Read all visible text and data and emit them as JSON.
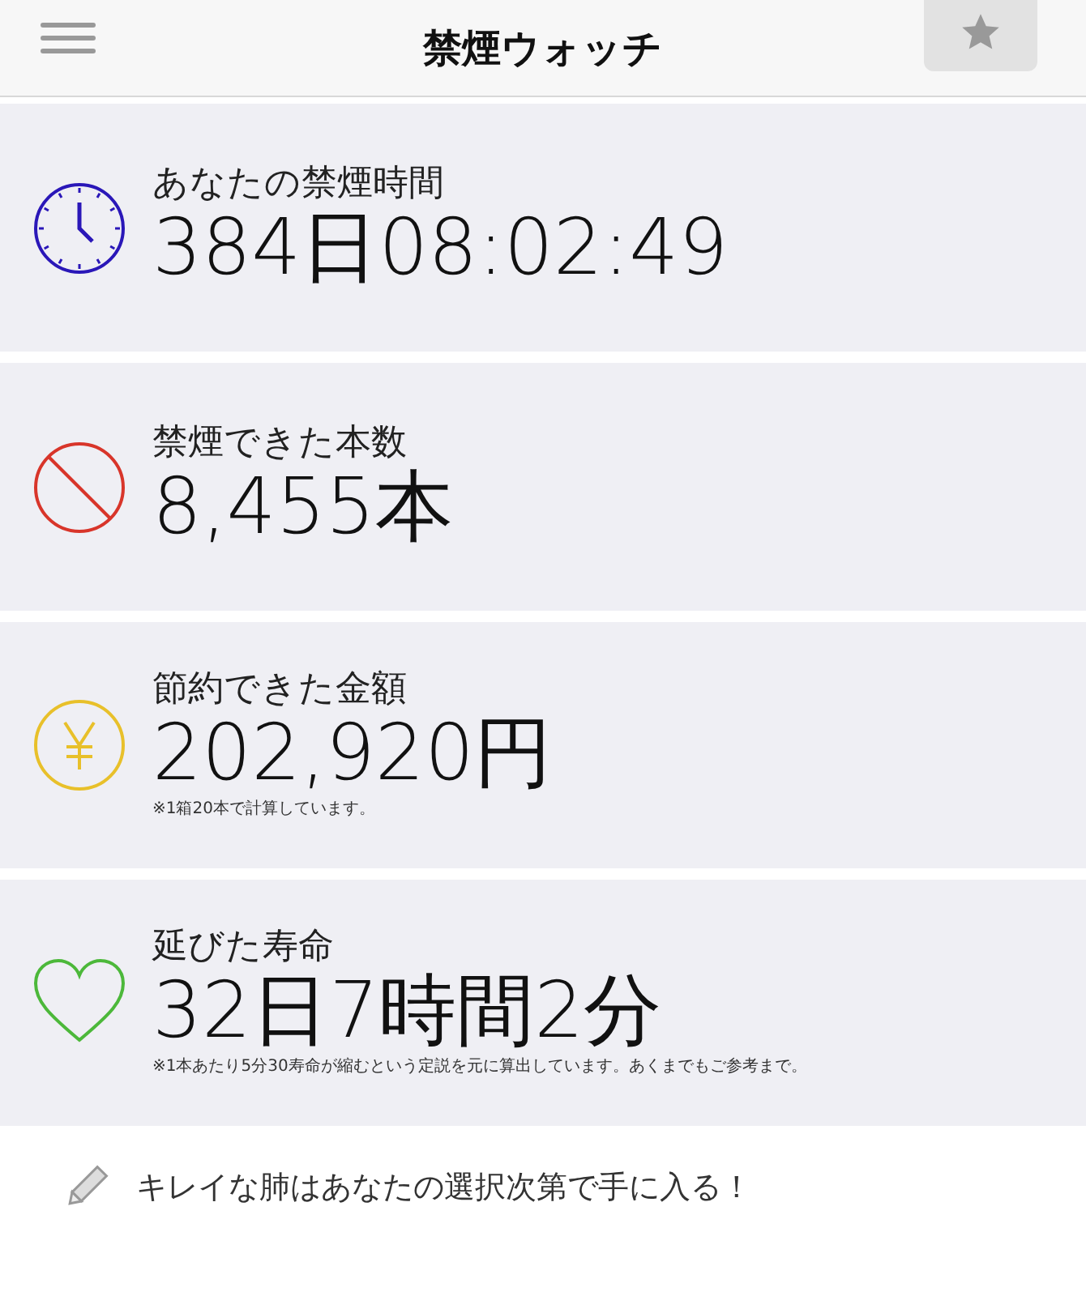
{
  "header": {
    "title": "禁煙ウォッチ"
  },
  "stats": [
    {
      "kind": "clock",
      "color": "#2a17b8",
      "label": "あなたの禁煙時間",
      "value": "384日08:02:49"
    },
    {
      "kind": "prohibited",
      "color": "#d8352a",
      "label": "禁煙できた本数",
      "value": "8,455本"
    },
    {
      "kind": "yen",
      "color": "#e8c02a",
      "label": "節約できた金額",
      "value": "202,920円",
      "note": "※1箱20本で計算しています。"
    },
    {
      "kind": "heart",
      "color": "#4cb83a",
      "label": "延びた寿命",
      "value": "32日7時間2分",
      "note": "※1本あたり5分30寿命が縮むという定説を元に算出しています。あくまでもご参考まで。"
    }
  ],
  "footer": {
    "message": "キレイな肺はあなたの選択次第で手に入る！"
  }
}
